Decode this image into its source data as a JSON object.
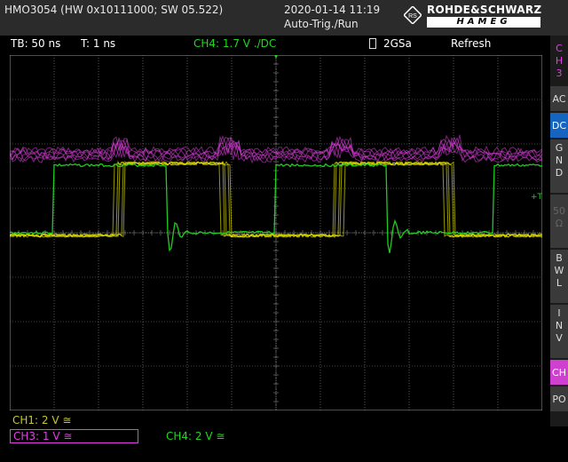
{
  "header": {
    "title": "HMO3054 (HW 0x10111000; SW 05.522)",
    "datetime": "2020-01-14 11:19",
    "mode": "Auto-Trig./Run",
    "logo_brand": "ROHDE&SCHWARZ",
    "logo_sub": "HAMEG"
  },
  "status": {
    "timebase": "TB: 50 ns",
    "trigger_time": "T: 1 ns",
    "trigger_channel": "CH4: 1.7 V ./DC",
    "sample_rate": "2GSa",
    "acquire_mode": "Refresh"
  },
  "side_menu": {
    "channel": [
      "C",
      "H",
      "3"
    ],
    "ac": "AC",
    "dc": "DC",
    "gnd": [
      "G",
      "N",
      "D"
    ],
    "fifty": [
      "50",
      "Ω"
    ],
    "bwl": [
      "B",
      "W",
      "L"
    ],
    "inv": [
      "I",
      "N",
      "V"
    ],
    "ch": "CH",
    "po": "PO"
  },
  "channels": {
    "ch1": "CH1: 2 V ≅",
    "ch3": "CH3: 1 V ≅",
    "ch4": "CH4: 2 V ≅"
  },
  "colors": {
    "ch1": "#e6e600",
    "ch3": "#e040e0",
    "ch4": "#22d622",
    "grid": "#8a8a8a",
    "dc_active": "#1565c0"
  },
  "icons": {
    "trigger_marker": "triangle-down-icon",
    "acquire": "memory-icon",
    "trigger_level": "trigger-level-icon"
  }
}
